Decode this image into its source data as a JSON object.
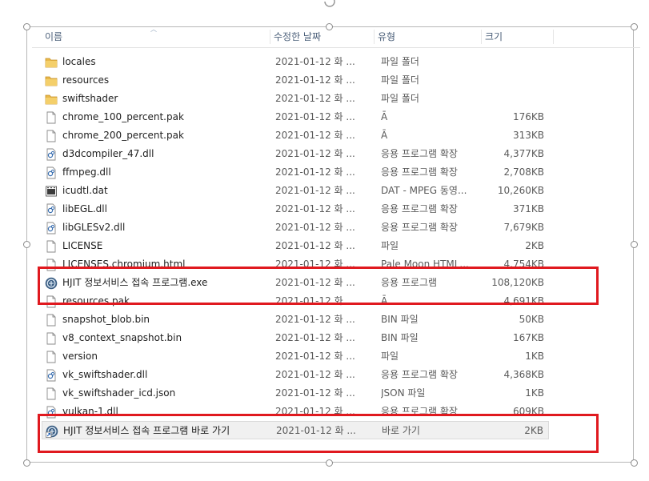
{
  "columns": {
    "name": "이름",
    "date": "수정한 날짜",
    "type": "유형",
    "size": "크기"
  },
  "files": [
    {
      "name": "locales",
      "date": "2021-01-12 화 ...",
      "type": "파일 폴더",
      "size": "",
      "icon": "folder-icon"
    },
    {
      "name": "resources",
      "date": "2021-01-12 화 ...",
      "type": "파일 폴더",
      "size": "",
      "icon": "folder-icon"
    },
    {
      "name": "swiftshader",
      "date": "2021-01-12 화 ...",
      "type": "파일 폴더",
      "size": "",
      "icon": "folder-icon"
    },
    {
      "name": "chrome_100_percent.pak",
      "date": "2021-01-12 화 ...",
      "type": "Ā",
      "size": "176KB",
      "icon": "file-icon"
    },
    {
      "name": "chrome_200_percent.pak",
      "date": "2021-01-12 화 ...",
      "type": "Ā",
      "size": "313KB",
      "icon": "file-icon"
    },
    {
      "name": "d3dcompiler_47.dll",
      "date": "2021-01-12 화 ...",
      "type": "응용 프로그램 확장",
      "size": "4,377KB",
      "icon": "dll-icon"
    },
    {
      "name": "ffmpeg.dll",
      "date": "2021-01-12 화 ...",
      "type": "응용 프로그램 확장",
      "size": "2,708KB",
      "icon": "dll-icon"
    },
    {
      "name": "icudtl.dat",
      "date": "2021-01-12 화 ...",
      "type": "DAT - MPEG 동영...",
      "size": "10,260KB",
      "icon": "video-file-icon"
    },
    {
      "name": "libEGL.dll",
      "date": "2021-01-12 화 ...",
      "type": "응용 프로그램 확장",
      "size": "371KB",
      "icon": "dll-icon"
    },
    {
      "name": "libGLESv2.dll",
      "date": "2021-01-12 화 ...",
      "type": "응용 프로그램 확장",
      "size": "7,679KB",
      "icon": "dll-icon"
    },
    {
      "name": "LICENSE",
      "date": "2021-01-12 화 ...",
      "type": "파일",
      "size": "2KB",
      "icon": "file-icon"
    },
    {
      "name": "LICENSES.chromium.html",
      "date": "2021-01-12 화 ...",
      "type": "Pale Moon HTML...",
      "size": "4,754KB",
      "icon": "html-file-icon"
    },
    {
      "name": "HJIT 정보서비스 접속 프로그램.exe",
      "date": "2021-01-12 화 ...",
      "type": "응용 프로그램",
      "size": "108,120KB",
      "icon": "app-icon"
    },
    {
      "name": "resources.pak",
      "date": "2021-01-12 화 ...",
      "type": "Ā",
      "size": "4,691KB",
      "icon": "file-icon"
    },
    {
      "name": "snapshot_blob.bin",
      "date": "2021-01-12 화 ...",
      "type": "BIN 파일",
      "size": "50KB",
      "icon": "file-icon"
    },
    {
      "name": "v8_context_snapshot.bin",
      "date": "2021-01-12 화 ...",
      "type": "BIN 파일",
      "size": "167KB",
      "icon": "file-icon"
    },
    {
      "name": "version",
      "date": "2021-01-12 화 ...",
      "type": "파일",
      "size": "1KB",
      "icon": "file-icon"
    },
    {
      "name": "vk_swiftshader.dll",
      "date": "2021-01-12 화 ...",
      "type": "응용 프로그램 확장",
      "size": "4,368KB",
      "icon": "dll-icon"
    },
    {
      "name": "vk_swiftshader_icd.json",
      "date": "2021-01-12 화 ...",
      "type": "JSON 파일",
      "size": "1KB",
      "icon": "file-icon"
    },
    {
      "name": "vulkan-1.dll",
      "date": "2021-01-12 화 ...",
      "type": "응용 프로그램 확장",
      "size": "609KB",
      "icon": "dll-icon"
    },
    {
      "name": "HJIT 정보서비스 접속 프로그램 바로 가기",
      "date": "2021-01-12 화 ...",
      "type": "바로 가기",
      "size": "2KB",
      "icon": "shortcut-app-icon",
      "selected": true
    }
  ],
  "colors": {
    "annotation_red": "#e0191f",
    "header_text": "#4c607a",
    "folder": "#e8b84a"
  }
}
